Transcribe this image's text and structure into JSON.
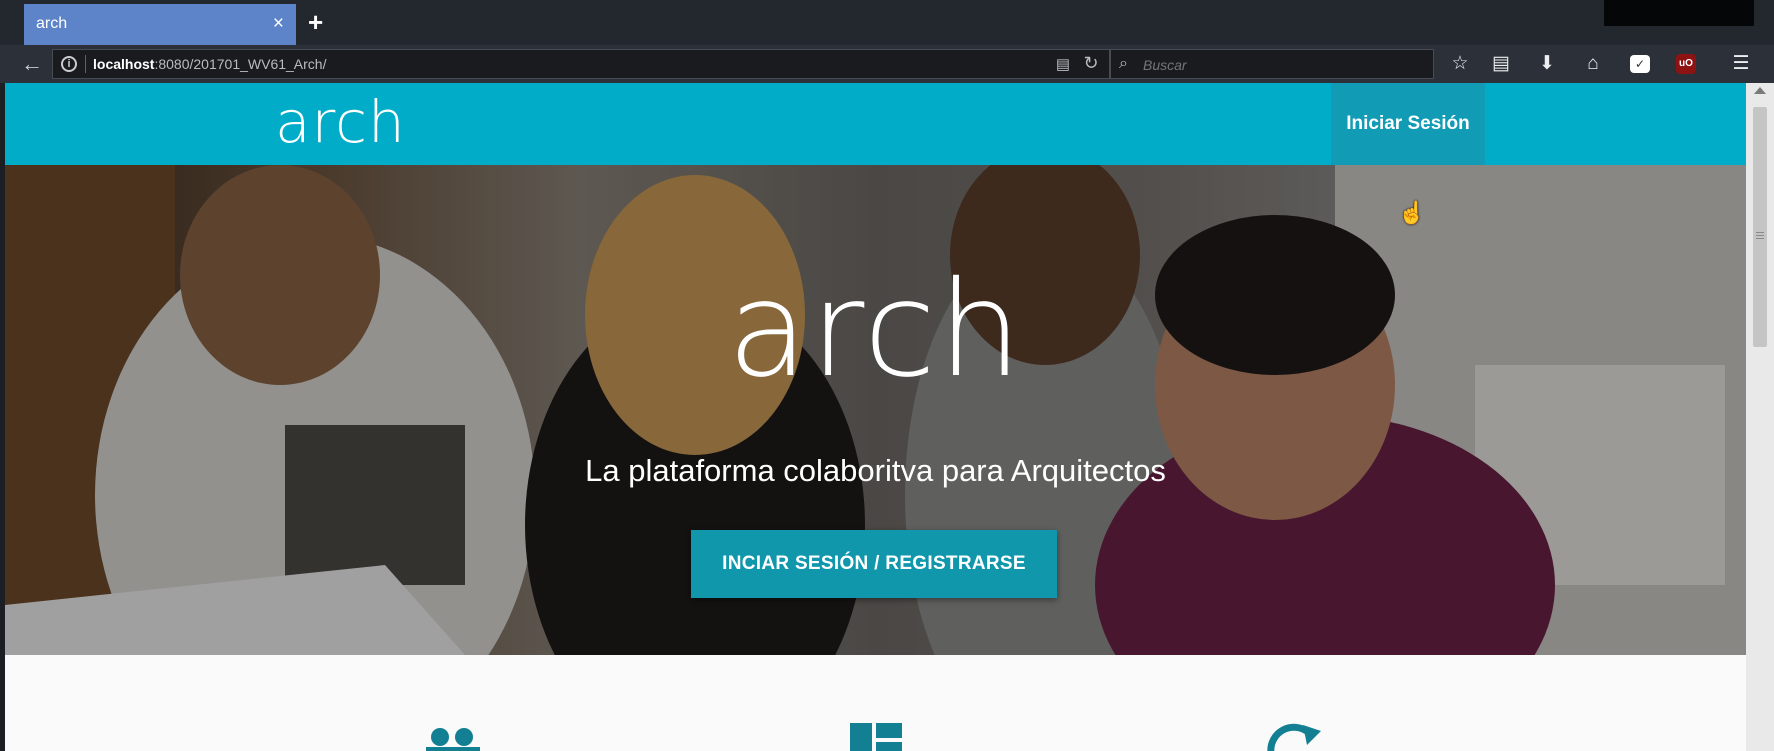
{
  "browser": {
    "tab_title": "arch",
    "tab_close": "×",
    "new_tab": "+",
    "url_host": "localhost",
    "url_path": ":8080/201701_WV61_Arch/",
    "search_placeholder": "Buscar",
    "ublock_label": "uO"
  },
  "site": {
    "logo": "arch",
    "nav_login": "Iniciar Sesión",
    "hero_title": "arch",
    "hero_subtitle": "La plataforma colaboritva para Arquitectos",
    "hero_button": "INCIAR SESIÓN / REGISTRARSE"
  },
  "icons": {
    "back": "arrow-left-icon",
    "info": "info-icon",
    "reader": "reader-view-icon",
    "reload": "reload-icon",
    "search": "search-icon",
    "bookmark_star": "star-icon",
    "library": "library-icon",
    "download": "download-icon",
    "home": "home-icon",
    "pocket": "pocket-icon",
    "ublock": "ublock-icon",
    "menu": "hamburger-menu-icon",
    "features": [
      "users-icon",
      "dashboard-icon",
      "sync-icon"
    ]
  },
  "colors": {
    "header": "#00acc8",
    "button": "#1097ac",
    "tab_active": "#5d84c8"
  }
}
